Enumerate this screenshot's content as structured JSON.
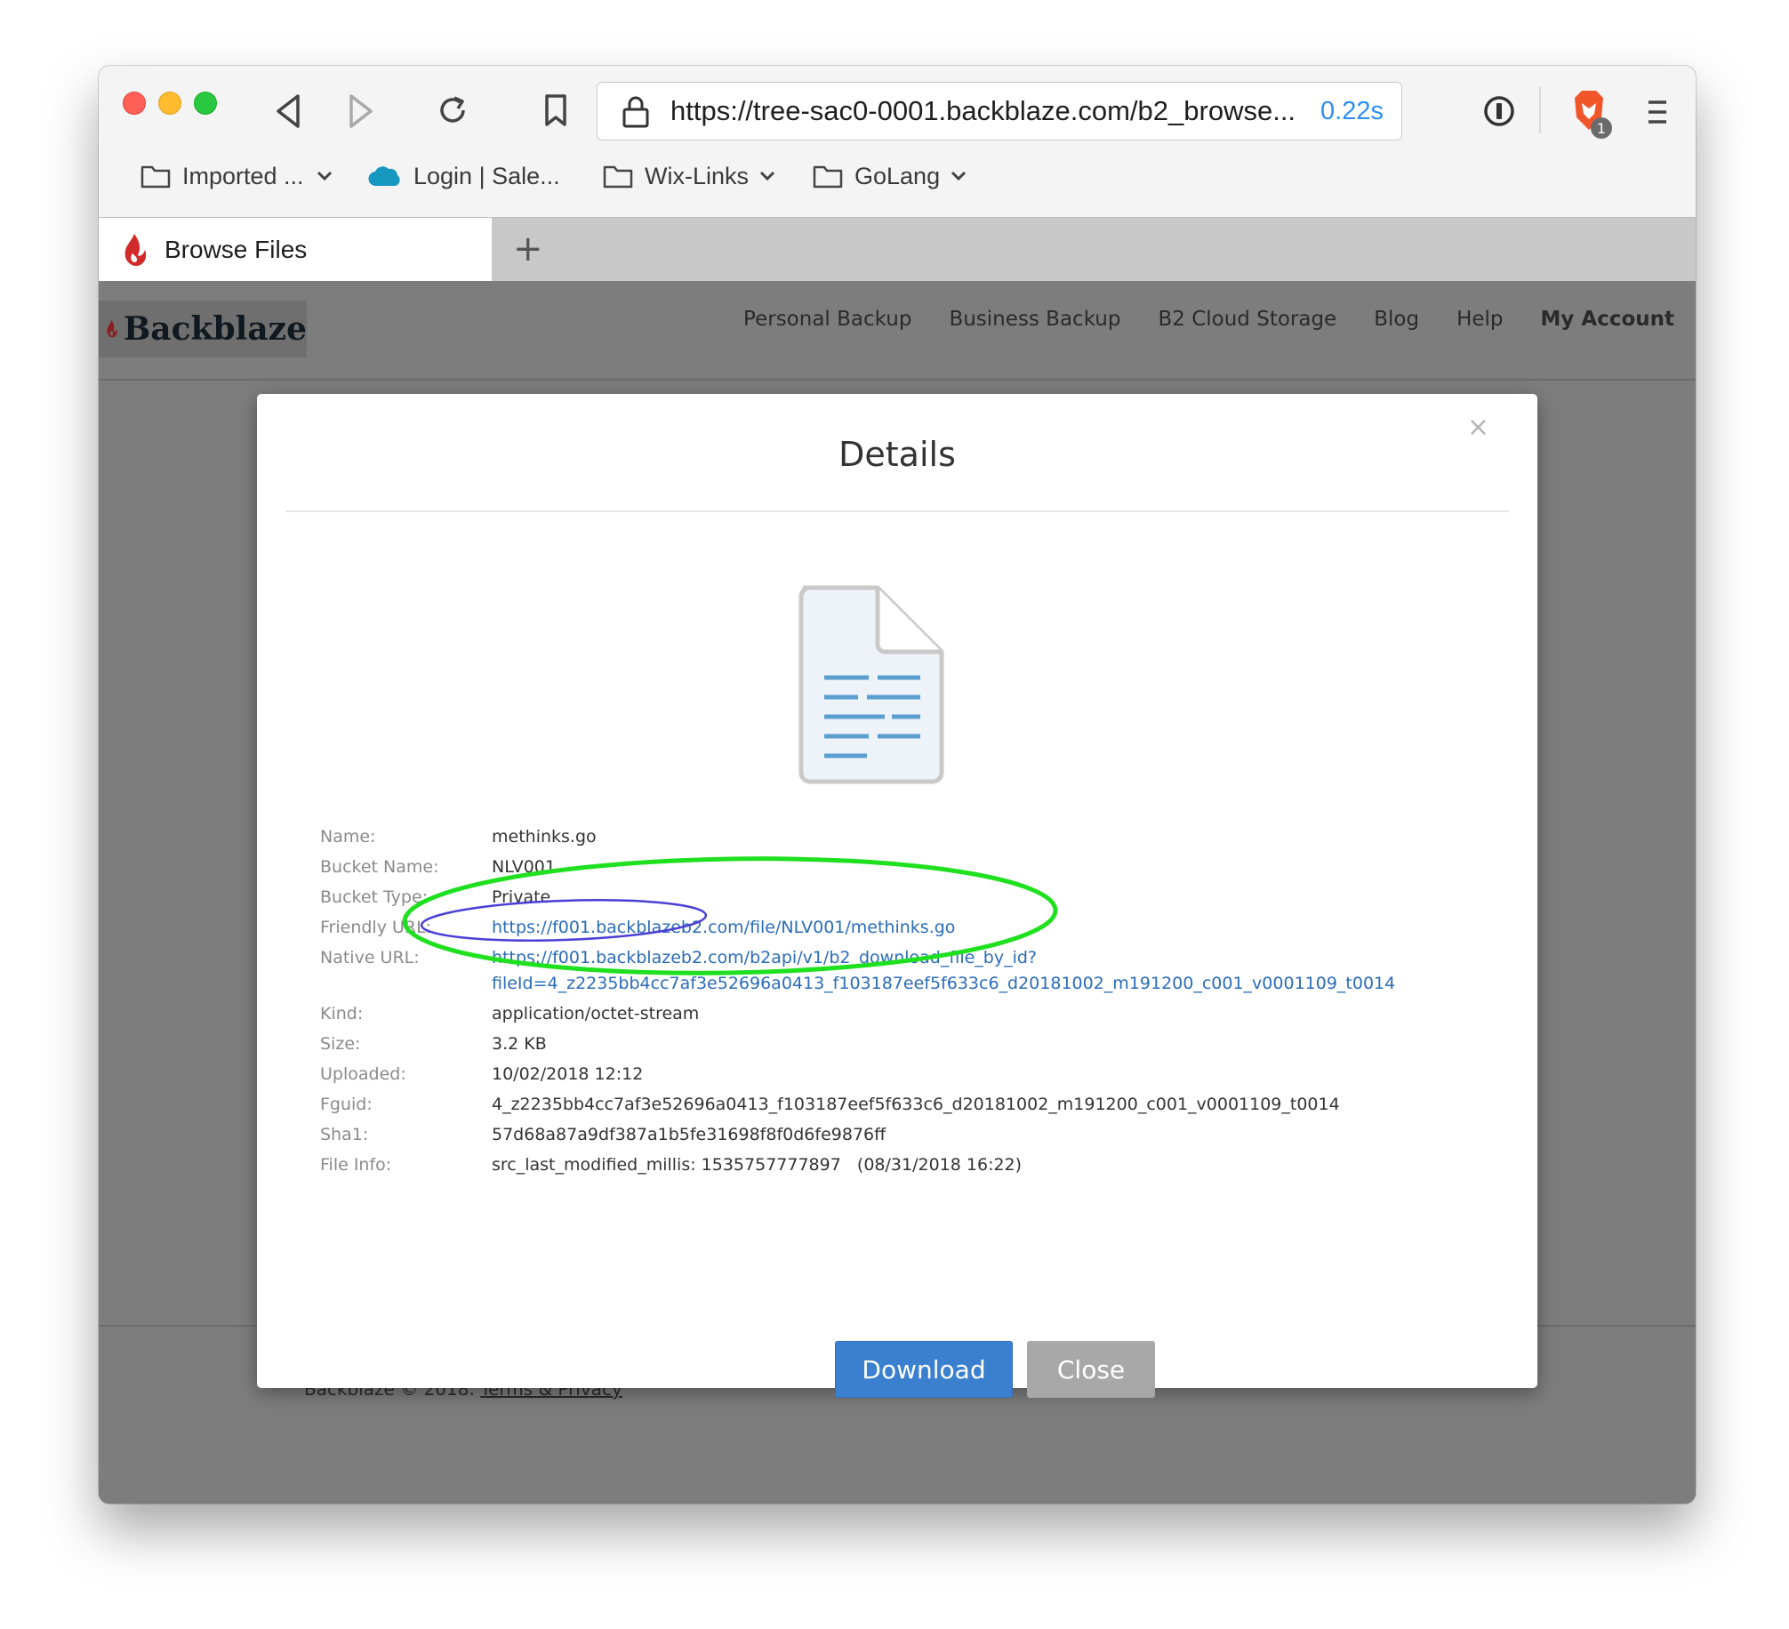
{
  "browser": {
    "url": "https://tree-sac0-0001.backblaze.com/b2_browse...",
    "load_time": "0.22s",
    "shields_count": "1",
    "bookmarks": [
      {
        "label": "Imported ...",
        "icon": "folder-icon",
        "dropdown": true
      },
      {
        "label": "Login | Sale...",
        "icon": "salesforce-cloud-icon",
        "dropdown": false
      },
      {
        "label": "Wix-Links",
        "icon": "folder-icon",
        "dropdown": true
      },
      {
        "label": "GoLang",
        "icon": "folder-icon",
        "dropdown": true
      }
    ],
    "tab": {
      "title": "Browse Files",
      "icon": "backblaze-flame-icon"
    },
    "new_tab": "+"
  },
  "site": {
    "logo": "Backblaze",
    "nav": [
      "Personal Backup",
      "Business Backup",
      "B2 Cloud Storage",
      "Blog",
      "Help",
      "My Account"
    ],
    "footer": {
      "text": "Backblaze © 2018.",
      "link": "Terms & Privacy"
    }
  },
  "modal": {
    "title": "Details",
    "close": "×",
    "fields": {
      "name": {
        "label": "Name:",
        "value": "methinks.go"
      },
      "bucket_name": {
        "label": "Bucket Name:",
        "value": "NLV001"
      },
      "bucket_type": {
        "label": "Bucket Type:",
        "value": "Private"
      },
      "friendly_url": {
        "label": "Friendly URL:",
        "value": "https://f001.backblazeb2.com/file/NLV001/methinks.go"
      },
      "native_url": {
        "label": "Native URL:",
        "value_line1": "https://f001.backblazeb2.com/b2api/v1/b2_download_file_by_id?",
        "value_line2": "fileId=4_z2235bb4cc7af3e52696a0413_f103187eef5f633c6_d20181002_m191200_c001_v0001109_t0014"
      },
      "kind": {
        "label": "Kind:",
        "value": "application/octet-stream"
      },
      "size": {
        "label": "Size:",
        "value": "3.2 KB"
      },
      "uploaded": {
        "label": "Uploaded:",
        "value": "10/02/2018 12:12"
      },
      "fguid": {
        "label": "Fguid:",
        "value": "4_z2235bb4cc7af3e52696a0413_f103187eef5f633c6_d20181002_m191200_c001_v0001109_t0014"
      },
      "sha1": {
        "label": "Sha1:",
        "value": "57d68a87a9df387a1b5fe31698f8f0d6fe9876ff"
      },
      "file_info": {
        "label": "File Info:",
        "value": "src_last_modified_millis: 1535757777897   (08/31/2018 16:22)"
      }
    },
    "buttons": {
      "download": "Download",
      "close": "Close"
    }
  },
  "annotations": {
    "green_ellipse_color": "#1fe01f",
    "purple_ellipse_color": "#4b3fd6"
  }
}
